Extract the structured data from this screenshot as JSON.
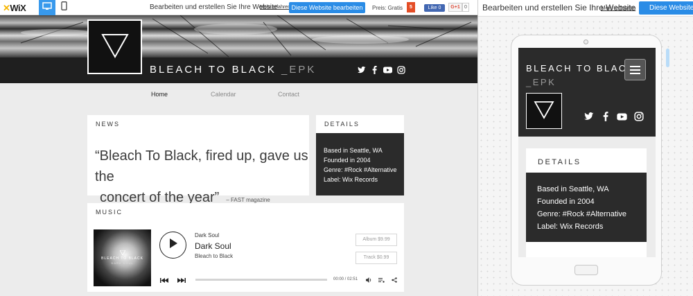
{
  "wix_bar": {
    "logo": "WiX",
    "views": [
      {
        "icon": "desktop-icon",
        "active": true
      },
      {
        "icon": "mobile-icon",
        "active": false
      }
    ],
    "promo_text": "Bearbeiten und erstellen Sie Ihre Website",
    "learn_more": "Mehr erfahren",
    "edit_button": "Diese Website bearbeiten",
    "price": "Preis: Gratis",
    "html5_badge": "5",
    "fb_like": "Like 0",
    "gplus_label": "G+1",
    "gplus_count": "0",
    "accent_color": "#2a8ce6"
  },
  "site": {
    "band_name": "BLEACH TO BLACK",
    "band_suffix": "_EPK",
    "social_icons": [
      "twitter-icon",
      "facebook-icon",
      "youtube-icon",
      "instagram-icon"
    ],
    "nav": [
      {
        "label": "Home",
        "active": true
      },
      {
        "label": "Calendar",
        "active": false
      },
      {
        "label": "Contact",
        "active": false
      }
    ],
    "news": {
      "heading": "NEWS",
      "quote_line1": "“Bleach To Black, fired up, gave us the",
      "quote_line2": "concert of the year”",
      "source": "– FAST magazine"
    },
    "details": {
      "heading": "DETAILS",
      "lines": [
        "Based in Seattle, WA",
        "Founded in 2004",
        "Genre: #Rock #Alternative",
        "Label: Wix Records"
      ]
    },
    "music": {
      "heading": "MUSIC",
      "album_art_title": "BLEACH TO BLACK",
      "album_art_subtitle": "DARK SOUL",
      "album_small": "Dark Soul",
      "track_title": "Dark Soul",
      "artist": "Bleach to Black",
      "album_price": "Album $9.99",
      "track_price": "Track $0.99",
      "time": "00:00 / 02:51",
      "progress": 0
    }
  },
  "mobile_pane": {
    "promo_text": "Bearbeiten und erstellen Sie Ihre Website",
    "learn_more": "Mehr erfahren",
    "edit_button": "Diese Website bearbeiten"
  },
  "mobile_site": {
    "band_name": "BLEACH TO BLACK",
    "band_suffix": "_EPK",
    "details_heading": "DETAILS",
    "details_lines": [
      "Based in Seattle, WA",
      "Founded in 2004",
      "Genre: #Rock #Alternative",
      "Label: Wix Records"
    ]
  }
}
